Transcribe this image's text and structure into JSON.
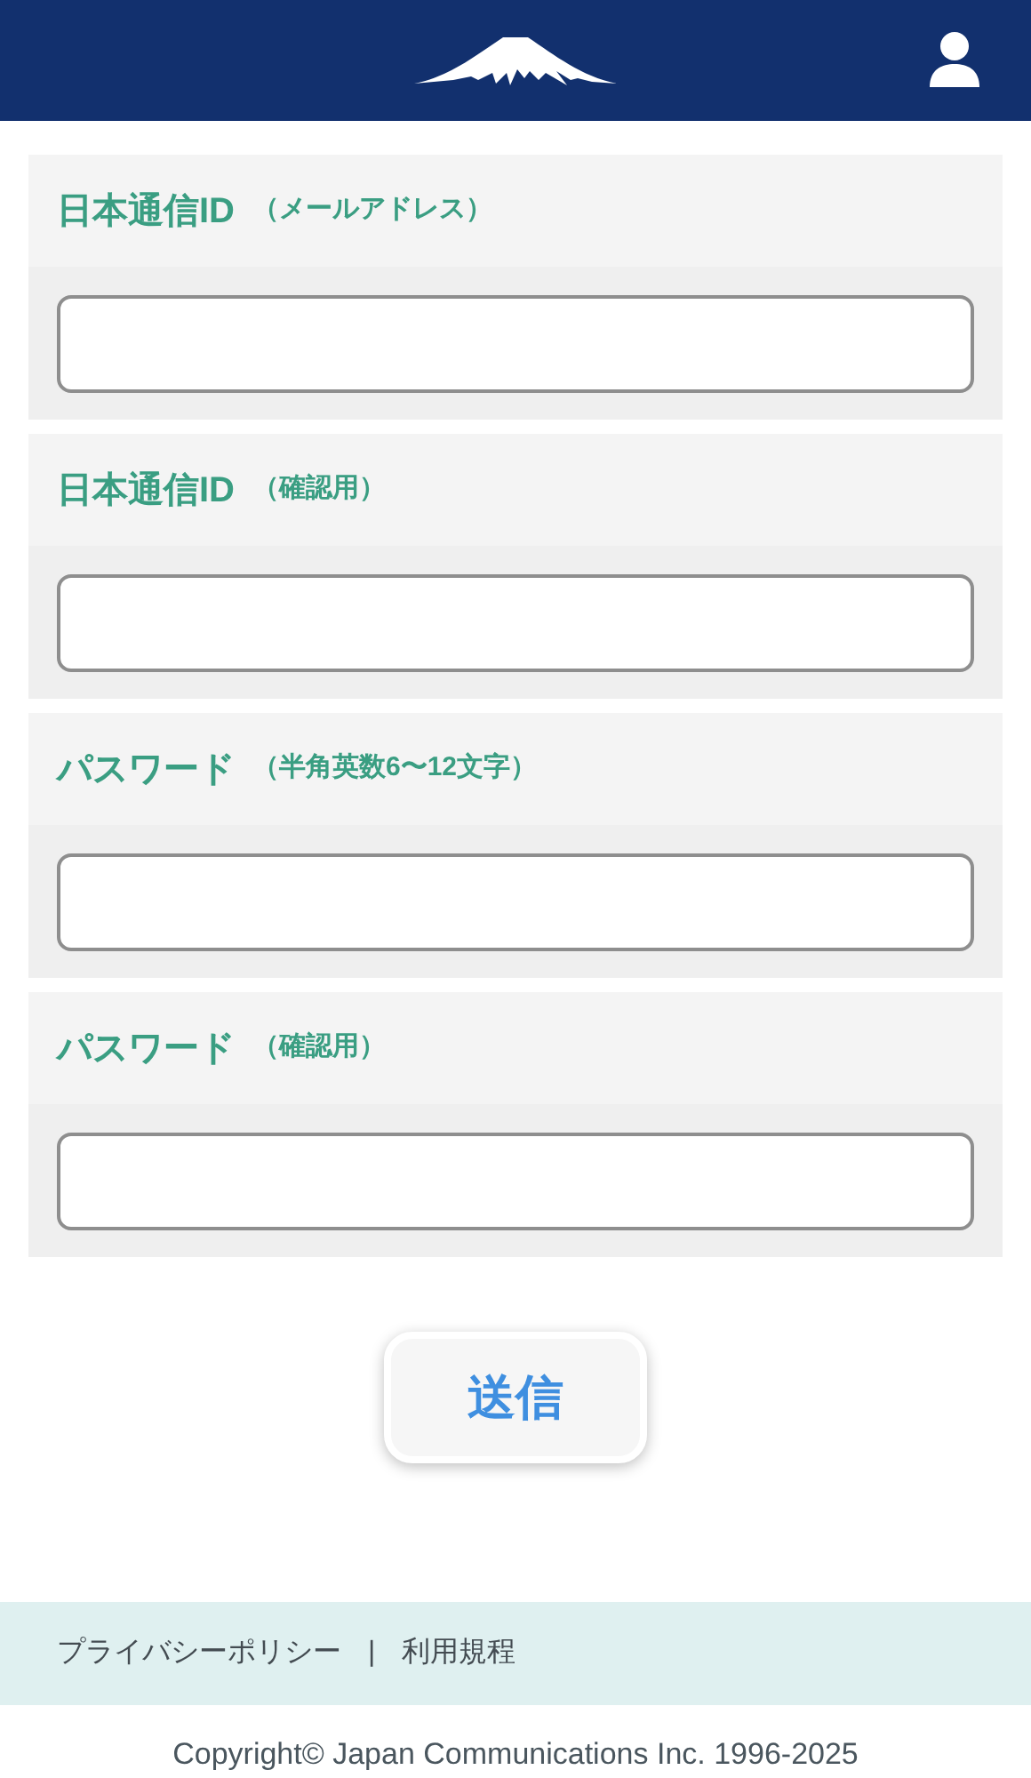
{
  "fields": [
    {
      "label": "日本通信ID",
      "note": "（メールアドレス）"
    },
    {
      "label": "日本通信ID",
      "note": "（確認用）"
    },
    {
      "label": "パスワード",
      "note": "（半角英数6〜12文字）"
    },
    {
      "label": "パスワード",
      "note": "（確認用）"
    }
  ],
  "submit_button": "送信",
  "footer": {
    "links": [
      "プライバシーポリシー",
      "利用規程"
    ],
    "separator": "|",
    "copyright": "Copyright© Japan Communications Inc. 1996-2025"
  }
}
